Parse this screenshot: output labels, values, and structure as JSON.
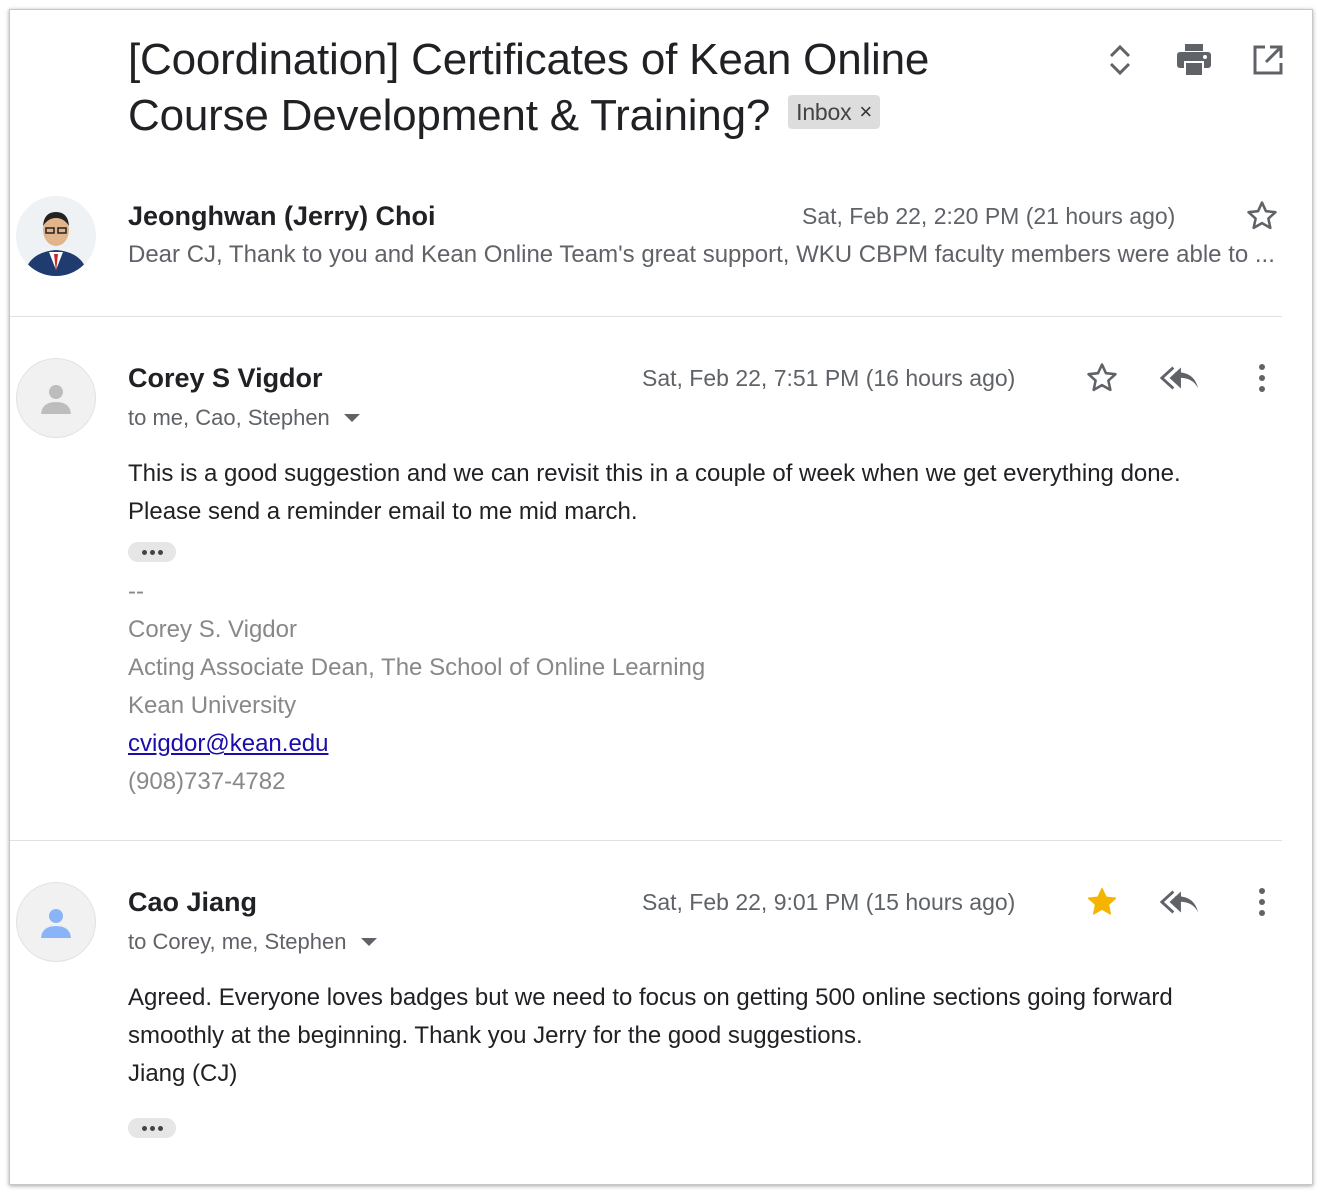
{
  "thread": {
    "subject": "[Coordination] Certificates of Kean Online Course Development & Training?",
    "label_chip": "Inbox",
    "label_remove": "×"
  },
  "icons": {
    "expand": "unfold-icon",
    "print": "print-icon",
    "open_new_window": "open-in-new-icon",
    "star": "star-icon",
    "reply_all": "reply-all-icon",
    "more": "more-vert-icon"
  },
  "colors": {
    "star_filled": "#f4b400",
    "link": "#1a0dab",
    "avatar_blue": "#8ab4f8",
    "avatar_gray": "#bdbdbd"
  },
  "messages": [
    {
      "sender": "Jeonghwan (Jerry) Choi",
      "date": "Sat, Feb 22, 2:20 PM (21 hours ago)",
      "snippet": "Dear CJ, Thank to you and Kean Online Team's great support, WKU CBPM faculty members were able to ...",
      "collapsed": true,
      "starred": false
    },
    {
      "sender": "Corey S Vigdor",
      "date": "Sat, Feb 22, 7:51 PM (16 hours ago)",
      "recipients": "to me, Cao, Stephen",
      "body_lines": [
        "This is a good suggestion and we can revisit this in a couple of week when we get everything done.",
        "Please send a reminder email to me mid march."
      ],
      "signature": {
        "separator": "--",
        "name": "Corey S. Vigdor",
        "title": "Acting Associate Dean, The School of Online Learning",
        "org": "Kean University",
        "email": "cvigdor@kean.edu",
        "phone": "(908)737-4782"
      },
      "starred": false
    },
    {
      "sender": "Cao Jiang",
      "date": "Sat, Feb 22, 9:01 PM (15 hours ago)",
      "recipients": "to Corey, me, Stephen",
      "body_lines": [
        "Agreed. Everyone loves badges but we need to focus on getting 500 online sections going forward",
        "smoothly at the beginning. Thank you Jerry for the good suggestions.",
        "Jiang (CJ)"
      ],
      "starred": true
    }
  ]
}
